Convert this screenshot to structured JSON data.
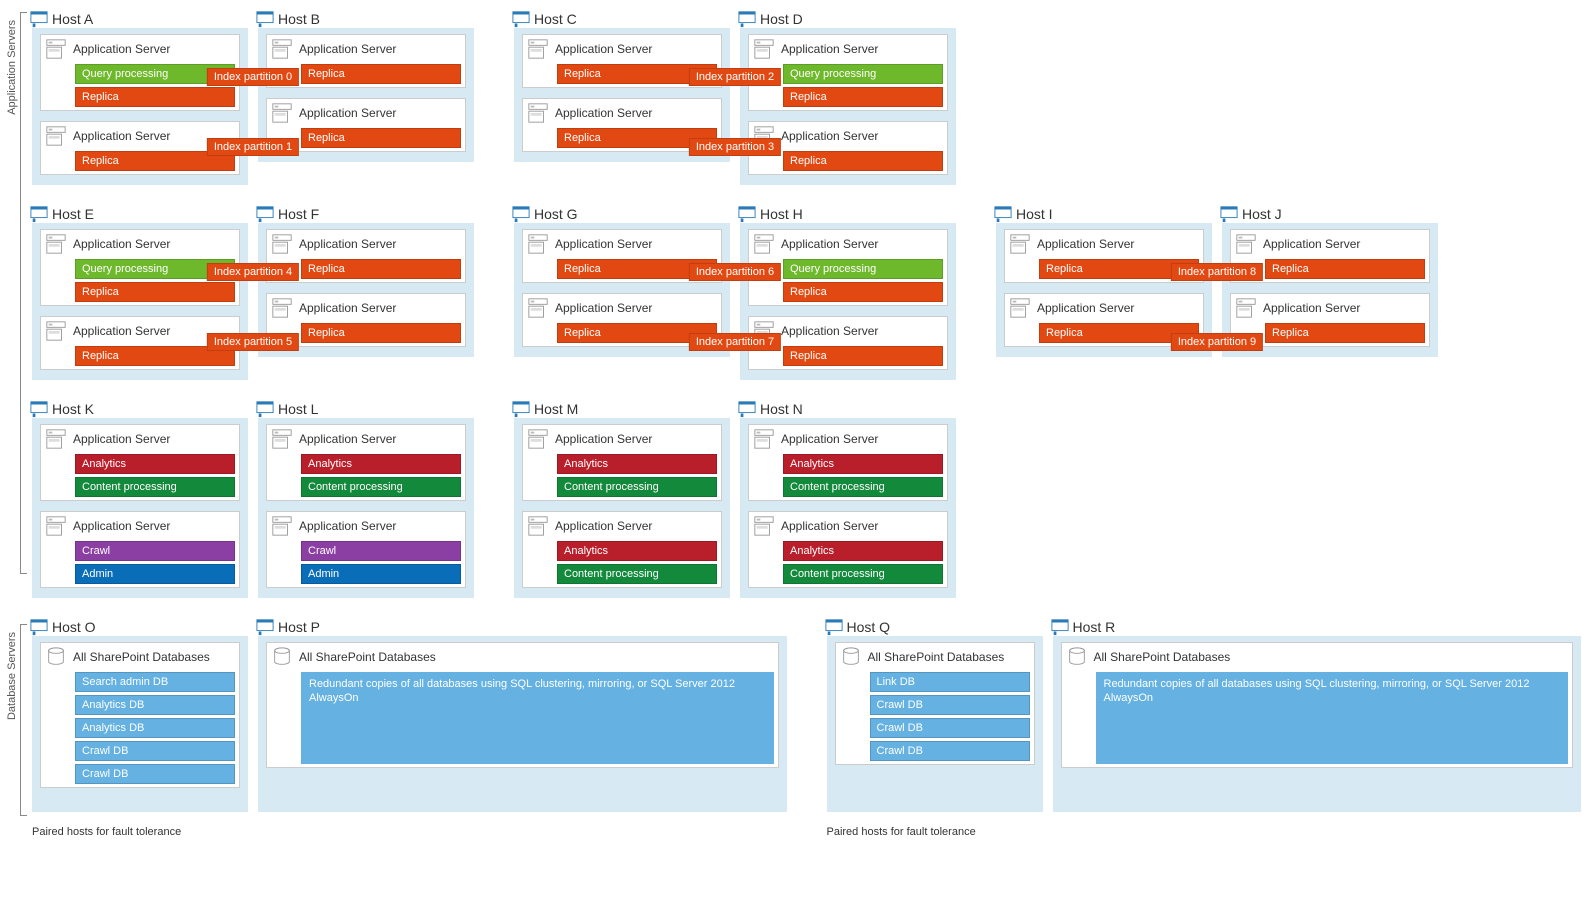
{
  "labels": {
    "section_app": "Application Servers",
    "section_db": "Database Servers",
    "app_server": "Application Server",
    "all_dbs": "All SharePoint Databases",
    "query_proc": "Query processing",
    "replica": "Replica",
    "analytics": "Analytics",
    "content_proc": "Content processing",
    "crawl": "Crawl",
    "admin": "Admin",
    "paired_caption": "Paired hosts for fault tolerance",
    "redundant_text": "Redundant copies of all databases using SQL clustering, mirroring, or SQL Server 2012 AlwaysOn"
  },
  "partitions": [
    "Index partition 0",
    "Index partition 1",
    "Index partition 2",
    "Index partition 3",
    "Index partition 4",
    "Index partition 5",
    "Index partition 6",
    "Index partition 7",
    "Index partition 8",
    "Index partition 9"
  ],
  "hosts": {
    "A": "Host A",
    "B": "Host B",
    "C": "Host C",
    "D": "Host D",
    "E": "Host E",
    "F": "Host F",
    "G": "Host G",
    "H": "Host H",
    "I": "Host I",
    "J": "Host J",
    "K": "Host K",
    "L": "Host L",
    "M": "Host M",
    "N": "Host N",
    "O": "Host O",
    "P": "Host P",
    "Q": "Host Q",
    "R": "Host R"
  },
  "dbs": {
    "O": [
      "Search admin DB",
      "Analytics DB",
      "Analytics DB",
      "Crawl DB",
      "Crawl DB"
    ],
    "Q": [
      "Link DB",
      "Crawl DB",
      "Crawl DB",
      "Crawl DB"
    ]
  }
}
